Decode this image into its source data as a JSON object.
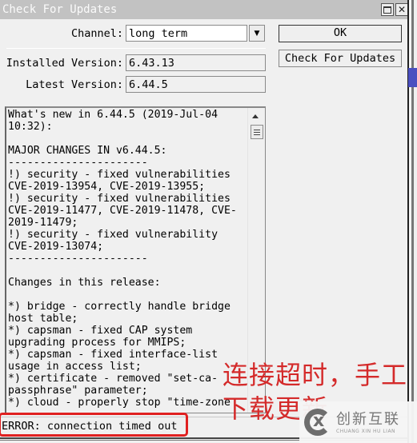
{
  "window": {
    "title": "Check For Updates",
    "controls": {
      "maximize_icon": "maximize-icon",
      "close_icon": "close-icon",
      "close_glyph": "✕"
    }
  },
  "form": {
    "channel_label": "Channel:",
    "channel_value": "long term",
    "dropdown_glyph": "▼",
    "installed_label": "Installed Version:",
    "installed_value": "6.43.13",
    "latest_label": "Latest Version:",
    "latest_value": "6.44.5"
  },
  "buttons": {
    "ok": "OK",
    "check_for_updates": "Check For Updates"
  },
  "release_notes": {
    "lines": [
      "What's new in 6.44.5 (2019-Jul-04",
      "10:32):",
      "",
      "MAJOR CHANGES IN v6.44.5:",
      "----------------------",
      "!) security - fixed vulnerabilities",
      "CVE-2019-13954, CVE-2019-13955;",
      "!) security - fixed vulnerabilities",
      "CVE-2019-11477, CVE-2019-11478, CVE-",
      "2019-11479;",
      "!) security - fixed vulnerability",
      "CVE-2019-13074;",
      "----------------------",
      "",
      "Changes in this release:",
      "",
      "*) bridge - correctly handle bridge",
      "host table;",
      "*) capsman - fixed CAP system",
      "upgrading process for MMIPS;",
      "*) capsman - fixed interface-list",
      "usage in access list;",
      "*) certificate - removed \"set-ca-",
      "passphrase\" parameter;",
      "*) cloud - properly stop \"time-zone"
    ]
  },
  "status": {
    "text": "ERROR: connection timed out"
  },
  "annotation": {
    "text": "连接超时，手工\n下载更新"
  },
  "watermark": {
    "name_cn": "创新互联",
    "name_en": "CHUANG XIN HU LIAN"
  }
}
